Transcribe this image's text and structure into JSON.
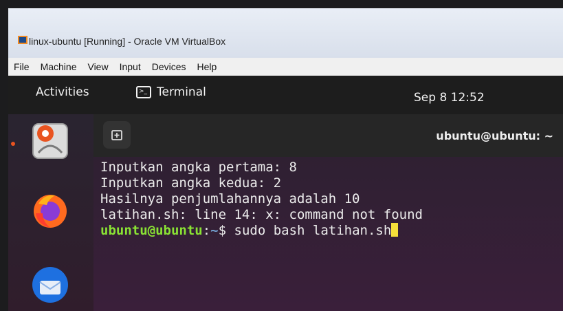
{
  "window": {
    "title": "linux-ubuntu [Running] - Oracle VM VirtualBox"
  },
  "menubar": {
    "items": [
      "File",
      "Machine",
      "View",
      "Input",
      "Devices",
      "Help"
    ]
  },
  "topbar": {
    "activities": "Activities",
    "app_name": "Terminal",
    "clock": "Sep 8  12:52"
  },
  "dock": {
    "apps": [
      "help-app-icon",
      "firefox-icon",
      "thunderbird-icon"
    ]
  },
  "terminal": {
    "title": "ubuntu@ubuntu: ~",
    "newtab_icon": "new-tab-icon",
    "lines": [
      "Inputkan angka pertama: 8",
      "Inputkan angka kedua: 2",
      "Hasilnya penjumlahannya adalah 10",
      "latihan.sh: line 14: x: command not found"
    ],
    "prompt": {
      "user_host": "ubuntu@ubuntu",
      "sep": ":",
      "path": "~",
      "symbol": "$ ",
      "command": "sudo bash latihan.sh"
    }
  },
  "colors": {
    "prompt_user": "#8ae234",
    "prompt_path": "#729fcf",
    "cursor": "#f5e03a",
    "accent": "#e95420"
  }
}
